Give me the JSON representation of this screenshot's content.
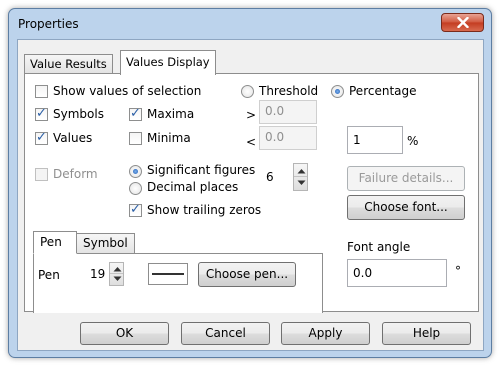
{
  "window": {
    "title": "Properties"
  },
  "tabs": [
    {
      "label": "Value Results",
      "active": false
    },
    {
      "label": "Values Display",
      "active": true
    }
  ],
  "options": {
    "show_values_of_selection": {
      "label": "Show values of selection",
      "checked": false
    },
    "symbols": {
      "label": "Symbols",
      "checked": true
    },
    "values": {
      "label": "Values",
      "checked": true
    },
    "maxima": {
      "label": "Maxima",
      "checked": true
    },
    "minima": {
      "label": "Minima",
      "checked": false
    },
    "deform": {
      "label": "Deform",
      "checked": false,
      "enabled": false
    },
    "show_trailing_zeros": {
      "label": "Show trailing zeros",
      "checked": true
    }
  },
  "mode": {
    "threshold_label": "Threshold",
    "percentage_label": "Percentage",
    "selected": "Percentage"
  },
  "threshold": {
    "greater_symbol": ">",
    "greater_value": "0.0",
    "less_symbol": "<",
    "less_value": "0.0"
  },
  "percentage": {
    "value": "1",
    "unit": "%"
  },
  "precision": {
    "significant_figures_label": "Significant figures",
    "decimal_places_label": "Decimal places",
    "selected": "Significant figures",
    "value": "6"
  },
  "buttons": {
    "failure_details": "Failure details...",
    "choose_font": "Choose font...",
    "choose_pen": "Choose pen...",
    "ok": "OK",
    "cancel": "Cancel",
    "apply": "Apply",
    "help": "Help"
  },
  "font_angle": {
    "label": "Font angle",
    "value": "0.0",
    "unit": "°"
  },
  "sub_tabs": [
    {
      "label": "Pen",
      "active": true
    },
    {
      "label": "Symbol",
      "active": false
    }
  ],
  "pen": {
    "label": "Pen",
    "width": "19"
  },
  "icons": {
    "close": "close-icon",
    "spin_up": "chevron-up-icon",
    "spin_down": "chevron-down-icon"
  },
  "colors": {
    "title_bar": "#bcd3ec",
    "close_button": "#c8452a",
    "dialog_face": "#f0f0f0",
    "accent": "#2b5fa6"
  }
}
